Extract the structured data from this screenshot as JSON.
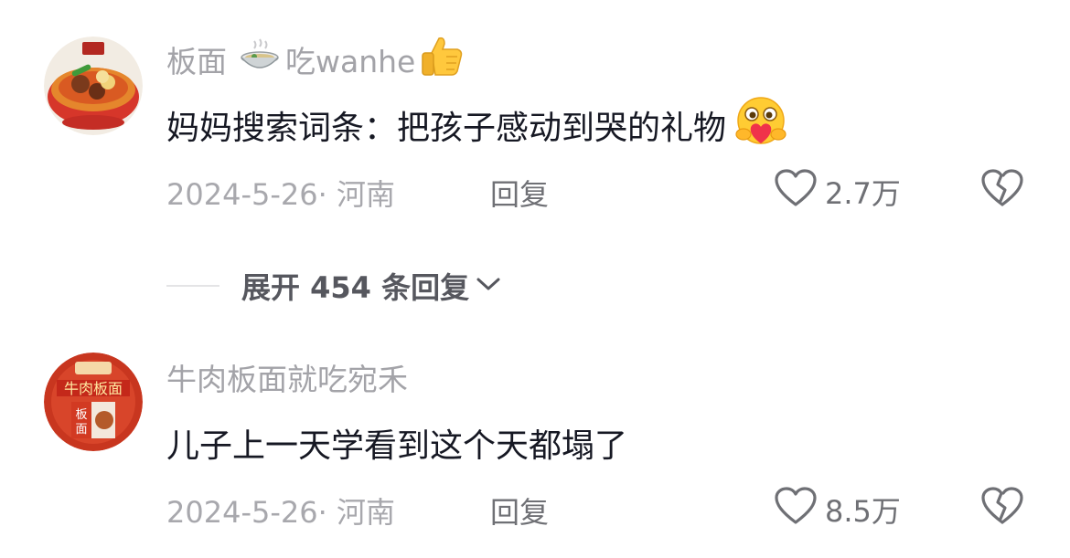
{
  "comments": [
    {
      "username": "板面",
      "username_suffix": "吃wanhe",
      "username_icons": [
        "noodle-bowl-icon",
        "thumbs-up-icon"
      ],
      "text": "妈妈搜索词条：把孩子感动到哭的礼物",
      "text_emoji": "heart-hug-face-icon",
      "date": "2024-5-26·",
      "location": "河南",
      "reply_label": "回复",
      "likes": "2.7万"
    },
    {
      "username": "牛肉板面就吃宛禾",
      "text": "儿子上一天学看到这个天都塌了",
      "date": "2024-5-26·",
      "location": "河南",
      "reply_label": "回复",
      "likes": "8.5万"
    }
  ],
  "expand_replies": {
    "label": "展开 454 条回复"
  },
  "colors": {
    "username": "#a3a3a8",
    "text": "#161823",
    "meta": "#a8a8ad",
    "action": "#6f7075"
  }
}
